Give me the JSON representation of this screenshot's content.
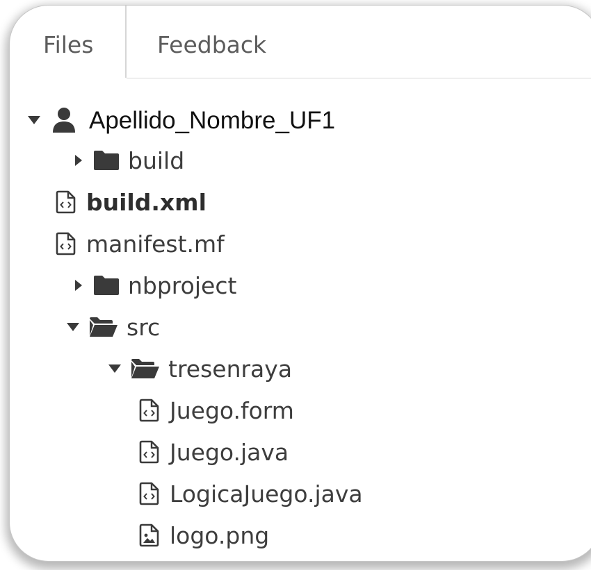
{
  "tabs": [
    {
      "label": "Files",
      "active": true
    },
    {
      "label": "Feedback",
      "active": false
    }
  ],
  "tree": {
    "root": {
      "label": "Apellido_Nombre_UF1",
      "icon": "user-icon",
      "expanded": true
    },
    "items": [
      {
        "label": "build",
        "type": "folder",
        "expanded": false
      },
      {
        "label": "build.xml",
        "type": "code-file",
        "bold": true
      },
      {
        "label": "manifest.mf",
        "type": "code-file"
      },
      {
        "label": "nbproject",
        "type": "folder",
        "expanded": false
      },
      {
        "label": "src",
        "type": "folder",
        "expanded": true
      },
      {
        "label": "tresenraya",
        "type": "folder",
        "expanded": true
      },
      {
        "label": "Juego.form",
        "type": "code-file"
      },
      {
        "label": "Juego.java",
        "type": "code-file"
      },
      {
        "label": "LogicaJuego.java",
        "type": "code-file"
      },
      {
        "label": "logo.png",
        "type": "image-file"
      }
    ]
  },
  "colors": {
    "text": "#3d3d3d",
    "icon": "#3a3a3a",
    "root_text": "#111111"
  }
}
